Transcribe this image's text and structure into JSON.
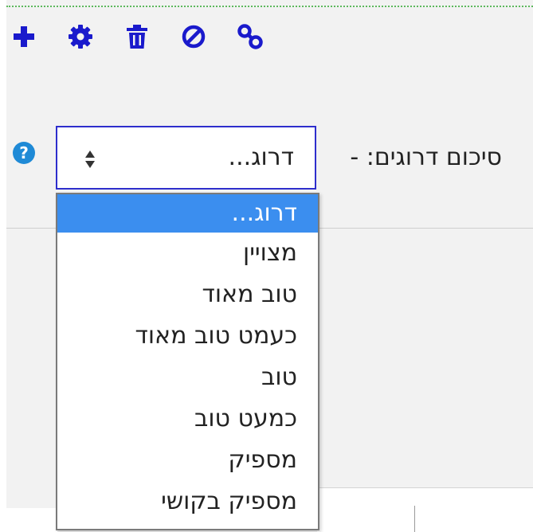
{
  "toolbar": {
    "icons": [
      "plus-icon",
      "gear-icon",
      "trash-icon",
      "block-icon",
      "link-icon"
    ],
    "icon_color": "#1a1acc"
  },
  "field": {
    "label": "סיכום דרוגים: -",
    "help_glyph": "?",
    "selected_value": "דרוג...",
    "border_color": "#2e2ecc"
  },
  "dropdown": {
    "highlight_color": "#3b8eef",
    "options": [
      "דרוג...",
      "מצויין",
      "טוב מאוד",
      "כעמט טוב מאוד",
      "טוב",
      "כמעט טוב",
      "מספיק",
      "מספיק בקושי"
    ]
  }
}
